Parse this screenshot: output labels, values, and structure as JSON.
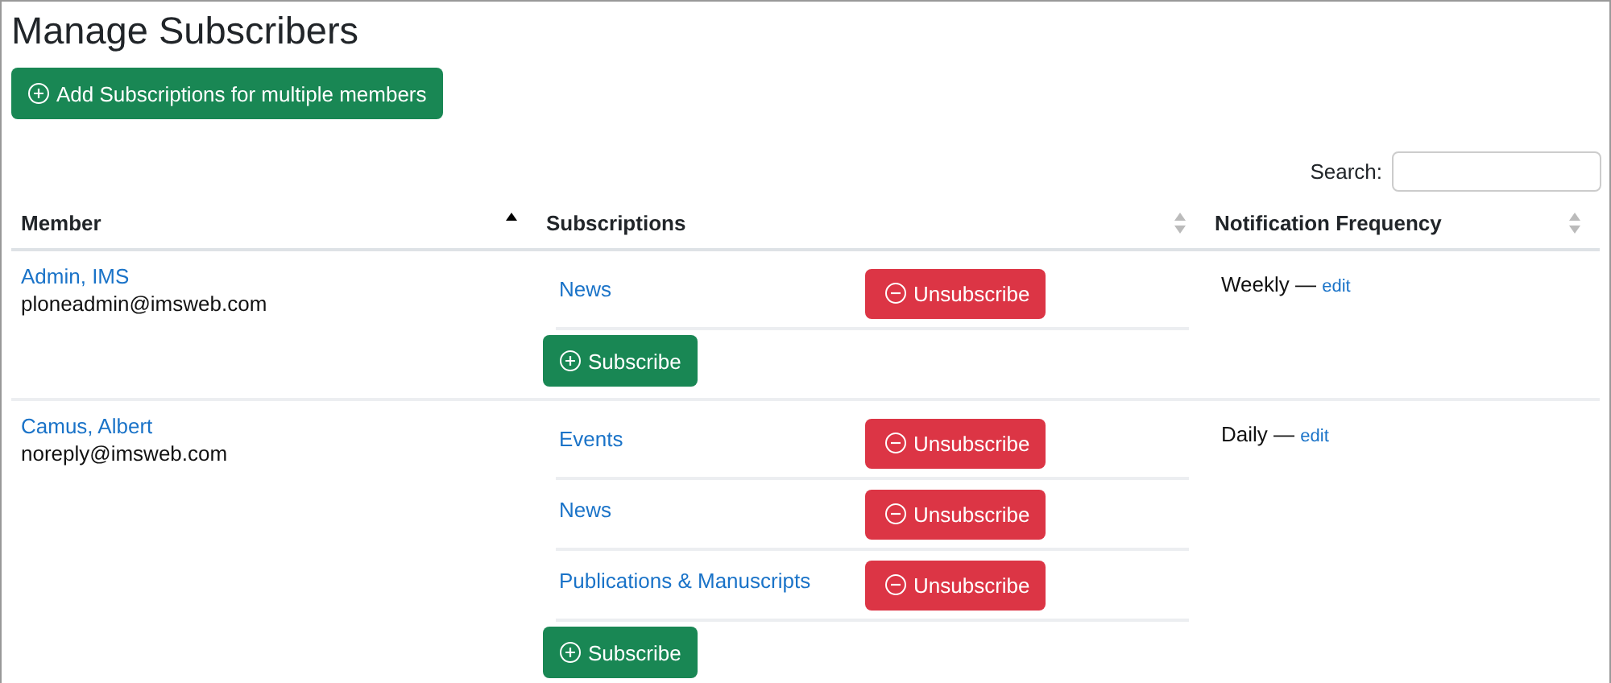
{
  "title": "Manage Subscribers",
  "add_button": {
    "label": "Add Subscriptions for multiple members"
  },
  "search": {
    "label": "Search:"
  },
  "table": {
    "columns": [
      {
        "label": "Member",
        "sorted": true
      },
      {
        "label": "Subscriptions",
        "sorted": false
      },
      {
        "label": "Notification Frequency",
        "sorted": false
      }
    ],
    "rows": [
      {
        "name": "Admin, IMS",
        "email": "ploneadmin@imsweb.com",
        "subscriptions": [
          {
            "topic": "News",
            "action": "Unsubscribe"
          }
        ],
        "subscribe": "Subscribe",
        "frequency": "Weekly —",
        "edit": "edit"
      },
      {
        "name": "Camus, Albert",
        "email": "noreply@imsweb.com",
        "subscriptions": [
          {
            "topic": "Events",
            "action": "Unsubscribe"
          },
          {
            "topic": "News",
            "action": "Unsubscribe"
          },
          {
            "topic": "Publications & Manuscripts",
            "action": "Unsubscribe"
          }
        ],
        "subscribe": "Subscribe",
        "frequency": "Daily —",
        "edit": "edit"
      }
    ]
  }
}
